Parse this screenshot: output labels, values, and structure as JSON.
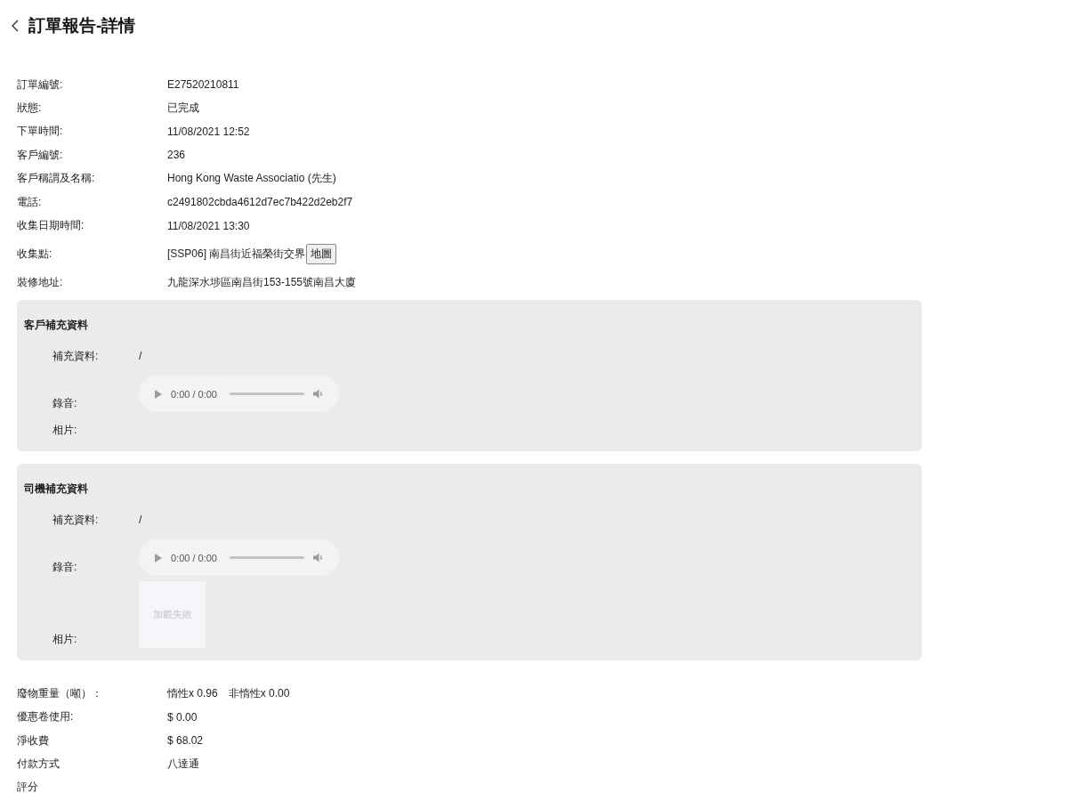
{
  "header": {
    "title": "訂單報告-詳情"
  },
  "details": [
    {
      "kind": "text",
      "label": "訂單編號:",
      "value": "E27520210811"
    },
    {
      "kind": "text",
      "label": "狀態:",
      "value": "已完成"
    },
    {
      "kind": "text",
      "label": "下單時間:",
      "value": "11/08/2021 12:52"
    },
    {
      "kind": "text",
      "label": "客戶編號:",
      "value": "236"
    },
    {
      "kind": "text",
      "label": "客戶稱謂及名稱:",
      "value": "Hong Kong Waste Associatio (先生)"
    },
    {
      "kind": "text",
      "label": "電話:",
      "value": "c2491802cbda4612d7ec7b422d2eb2f7"
    },
    {
      "kind": "text",
      "label": "收集日期時間:",
      "value": "11/08/2021 13:30"
    },
    {
      "kind": "map",
      "label": "收集點:",
      "value": "[SSP06] 南昌街近福榮街交界",
      "button": "地圖"
    },
    {
      "kind": "text",
      "label": "裝修地址:",
      "value": "九龍深水埗區南昌街153-155號南昌大廈"
    }
  ],
  "sections": [
    {
      "title": "客戶補充資料",
      "fields": [
        {
          "kind": "text",
          "label": "補充資料:",
          "value": "/"
        },
        {
          "kind": "audio",
          "label": "錄音:",
          "time": "0:00 / 0:00"
        },
        {
          "kind": "photo",
          "label": "相片:"
        }
      ]
    },
    {
      "title": "司機補充資料",
      "fields": [
        {
          "kind": "text",
          "label": "補充資料:",
          "value": "/"
        },
        {
          "kind": "audio",
          "label": "錄音:",
          "time": "0:00 / 0:00"
        },
        {
          "kind": "photo",
          "label": "相片:",
          "photos": [
            {
              "error": "加載失敗"
            }
          ]
        }
      ]
    }
  ],
  "summary": [
    {
      "kind": "weight",
      "label": "廢物重量（噸）：",
      "values": [
        "惰性x 0.96",
        "非惰性x 0.00"
      ]
    },
    {
      "kind": "text",
      "label": "優惠卷使用:",
      "value": "$ 0.00"
    },
    {
      "kind": "text",
      "label": "淨收費",
      "value": "$ 68.02"
    },
    {
      "kind": "text",
      "label": "付款方式",
      "value": "八達通"
    },
    {
      "kind": "label",
      "label": "評分"
    }
  ]
}
